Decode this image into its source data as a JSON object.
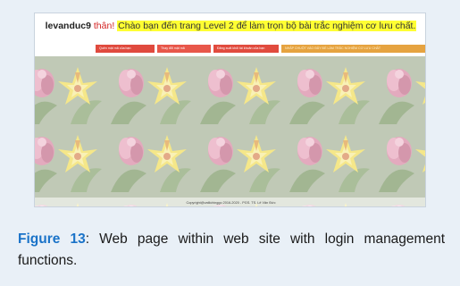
{
  "screenshot": {
    "greeting_user": "levanduc9",
    "greeting_suffix": " thân! ",
    "greeting_message": "Chào bạn đến trang Level 2 để làm trọn bộ bài trắc nghiệm cơ lưu chất.",
    "menu": [
      "Quên mật mã của bạn",
      "Thay đổi mật mã",
      "Đăng xuất khỏi tài khoản của bạn",
      "NHẤP CHUỘT VÀO ĐÂY ĐỂ LÀM TRẮC NGHIỆM CƠ LƯU CHẤT"
    ],
    "footer": "Copyright@vatlichinggo 2016-2020 - PGS. TS. Lê Văn Đức"
  },
  "caption": {
    "label": "Figure 13",
    "text": ": Web page within web site with login management functions."
  },
  "colors": {
    "figure_bg": "#e9f0f7",
    "caption_label": "#1a73c8",
    "highlight": "#ffff33",
    "than_red": "#d32222",
    "menu_red": "#e04a3e",
    "menu_orange": "#e6a340"
  }
}
